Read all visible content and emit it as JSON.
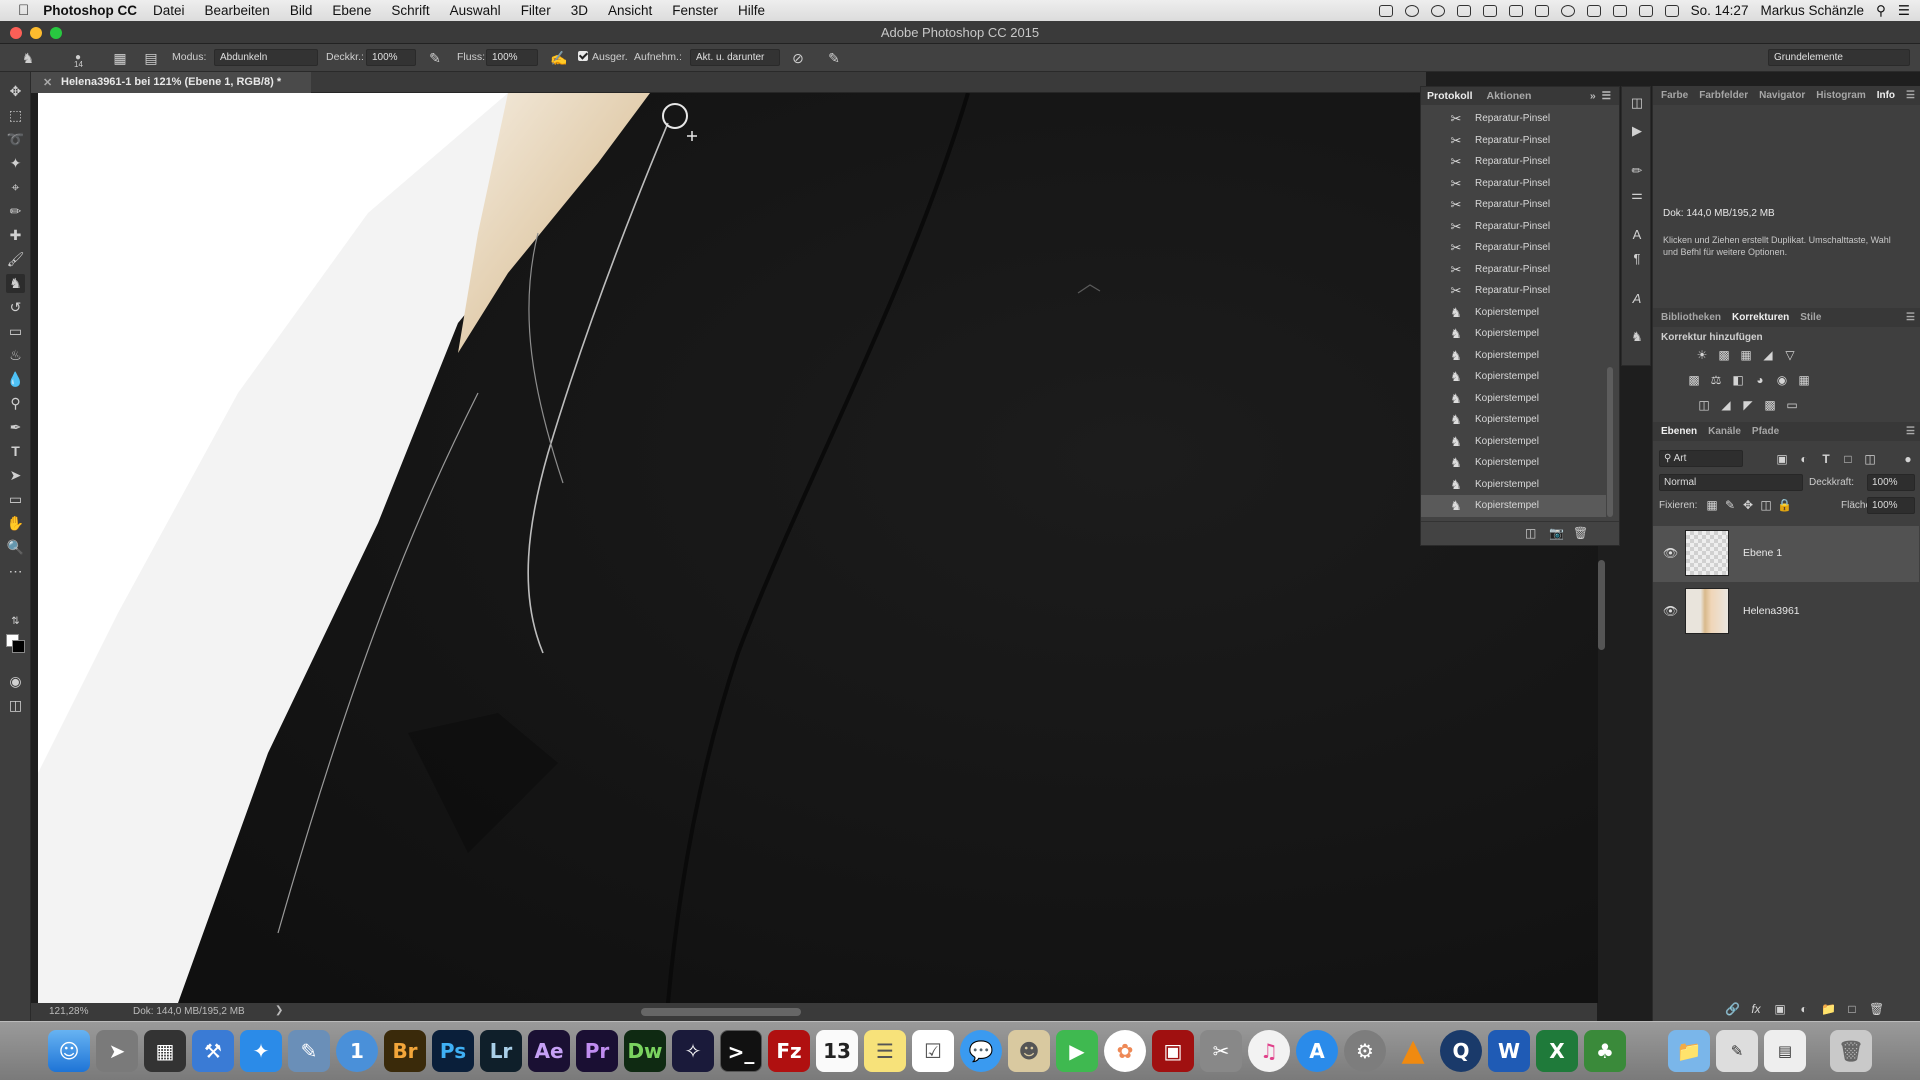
{
  "menubar": {
    "app_name": "Photoshop CC",
    "items": [
      "Datei",
      "Bearbeiten",
      "Bild",
      "Ebene",
      "Schrift",
      "Auswahl",
      "Filter",
      "3D",
      "Ansicht",
      "Fenster",
      "Hilfe"
    ],
    "clock": "So. 14:27",
    "user": "Markus Schänzle"
  },
  "window": {
    "title": "Adobe Photoshop CC 2015"
  },
  "options": {
    "brush_size": "14",
    "mode_label": "Modus:",
    "mode_value": "Abdunkeln",
    "opacity_label": "Deckkr.:",
    "opacity_value": "100%",
    "flow_label": "Fluss:",
    "flow_value": "100%",
    "aligned_label": "Ausger.",
    "sample_label": "Aufnehm.:",
    "sample_value": "Akt. u. darunter",
    "workspace": "Grundelemente"
  },
  "document": {
    "tab_title": "Helena3961-1 bei 121% (Ebene 1, RGB/8) *",
    "zoom": "121,28%",
    "doc_size": "Dok: 144,0 MB/195,2 MB"
  },
  "history": {
    "tabs": [
      "Protokoll",
      "Aktionen"
    ],
    "rows": [
      {
        "label": "Reparatur-Pinsel",
        "icon": "healing-brush-icon"
      },
      {
        "label": "Reparatur-Pinsel",
        "icon": "healing-brush-icon"
      },
      {
        "label": "Reparatur-Pinsel",
        "icon": "healing-brush-icon"
      },
      {
        "label": "Reparatur-Pinsel",
        "icon": "healing-brush-icon"
      },
      {
        "label": "Reparatur-Pinsel",
        "icon": "healing-brush-icon"
      },
      {
        "label": "Reparatur-Pinsel",
        "icon": "healing-brush-icon"
      },
      {
        "label": "Reparatur-Pinsel",
        "icon": "healing-brush-icon"
      },
      {
        "label": "Reparatur-Pinsel",
        "icon": "healing-brush-icon"
      },
      {
        "label": "Reparatur-Pinsel",
        "icon": "healing-brush-icon"
      },
      {
        "label": "Kopierstempel",
        "icon": "clone-stamp-icon"
      },
      {
        "label": "Kopierstempel",
        "icon": "clone-stamp-icon"
      },
      {
        "label": "Kopierstempel",
        "icon": "clone-stamp-icon"
      },
      {
        "label": "Kopierstempel",
        "icon": "clone-stamp-icon"
      },
      {
        "label": "Kopierstempel",
        "icon": "clone-stamp-icon"
      },
      {
        "label": "Kopierstempel",
        "icon": "clone-stamp-icon"
      },
      {
        "label": "Kopierstempel",
        "icon": "clone-stamp-icon"
      },
      {
        "label": "Kopierstempel",
        "icon": "clone-stamp-icon"
      },
      {
        "label": "Kopierstempel",
        "icon": "clone-stamp-icon"
      },
      {
        "label": "Kopierstempel",
        "icon": "clone-stamp-icon",
        "current": true
      }
    ]
  },
  "info_panel": {
    "tabs": [
      "Farbe",
      "Farbfelder",
      "Navigator",
      "Histogram",
      "Info"
    ],
    "doc": "Dok: 144,0 MB/195,2 MB",
    "hint": "Klicken und Ziehen erstellt Duplikat. Umschalttaste, Wahl und Befhl für weitere Optionen."
  },
  "adjustments_panel": {
    "tabs": [
      "Bibliotheken",
      "Korrekturen",
      "Stile"
    ],
    "heading": "Korrektur hinzufügen"
  },
  "layers_panel": {
    "tabs": [
      "Ebenen",
      "Kanäle",
      "Pfade"
    ],
    "filter": "Art",
    "blend_mode": "Normal",
    "opacity_label": "Deckkraft:",
    "opacity_value": "100%",
    "lock_label": "Fixieren:",
    "fill_label": "Fläche:",
    "fill_value": "100%",
    "layers": [
      {
        "name": "Ebene 1",
        "selected": true
      },
      {
        "name": "Helena3961",
        "selected": false
      }
    ]
  },
  "dock": {
    "apps": [
      "Finder",
      "Launchpad",
      "Mission Control",
      "Xcode",
      "Safari",
      "Preview",
      "1Password",
      "Br",
      "Ps",
      "Lr",
      "Ae",
      "Pr",
      "Dw",
      "Motion",
      "Terminal",
      "FileZilla",
      "Calendar",
      "Notes",
      "Reminders",
      "Messages",
      "Contacts",
      "FaceTime",
      "Photos",
      "Photo Booth",
      "Capture",
      "iTunes",
      "App Store",
      "System Preferences",
      "VLC",
      "QuickTime",
      "W",
      "X",
      "Evernote",
      "Folder",
      "Brushes",
      "Docs",
      "Trash"
    ],
    "calendar_day": "13"
  }
}
